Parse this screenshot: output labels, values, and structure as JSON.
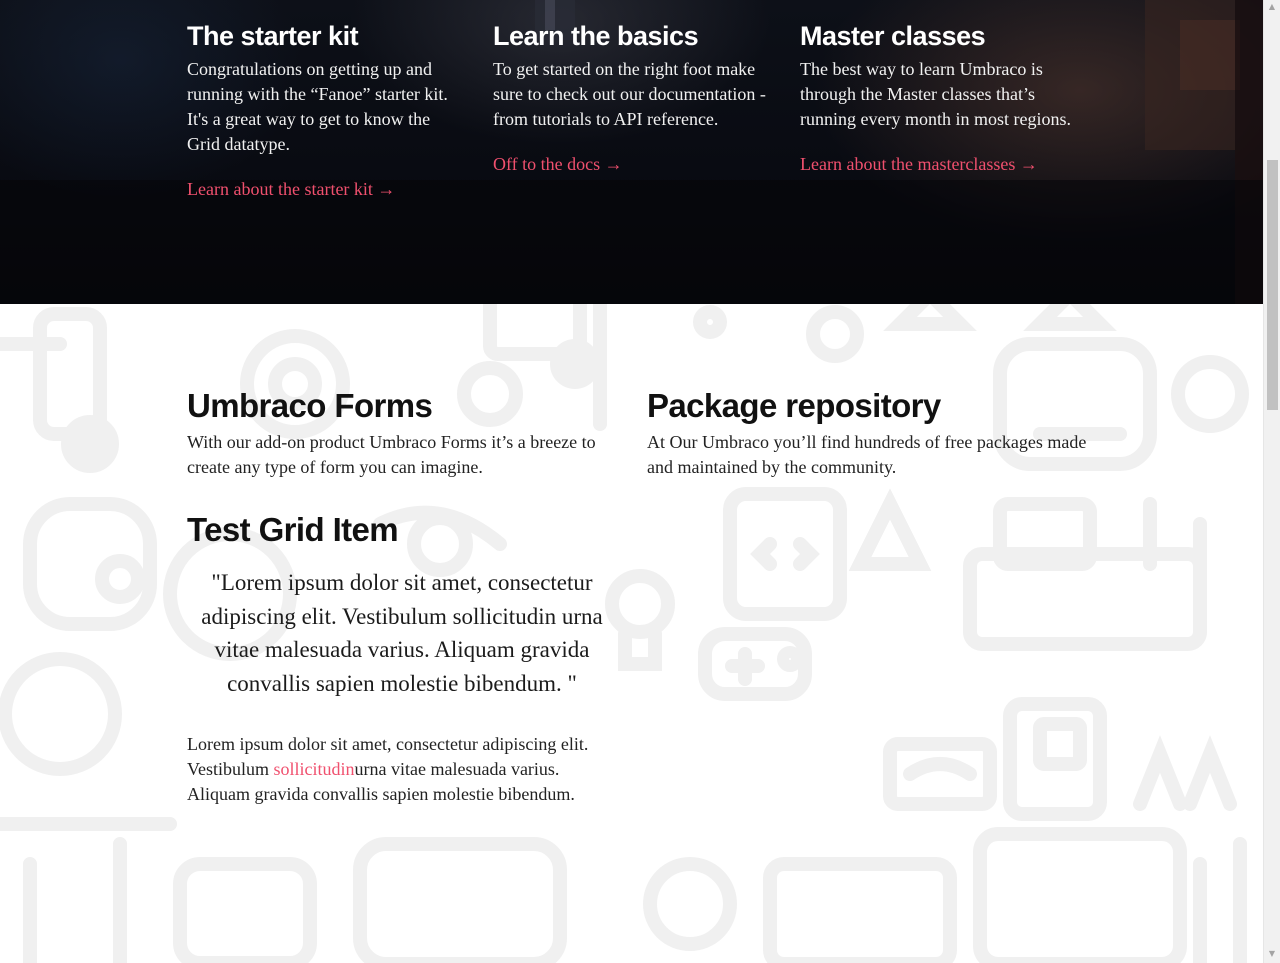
{
  "hero": {
    "columns": [
      {
        "title": "The starter kit",
        "text": "Congratulations on getting up and running with the “Fanoe” starter kit. It's a great way to get to know the Grid datatype.",
        "link": "Learn about the starter kit →"
      },
      {
        "title": "Learn the basics",
        "text": "To get started on the right foot make sure to check out our documentation - from tutorials to API reference.",
        "link": "Off to the docs →"
      },
      {
        "title": "Master classes",
        "text": "The best way to learn Umbraco is through the Master classes that’s running every month in most regions.",
        "link": "Learn about the masterclasses →"
      }
    ]
  },
  "forms": {
    "title": "Umbraco Forms",
    "text": "With our add-on product Umbraco Forms it’s a breeze to create any type of form you can imagine."
  },
  "packages": {
    "title": "Package repository",
    "text": "At Our Umbraco you’ll find hundreds of free packages made and maintained by the community."
  },
  "grid_item": {
    "title": "Test Grid Item",
    "quote_open": "\"",
    "quote": "Lorem ipsum dolor sit amet, consectetur adipiscing elit. Vestibulum sollicitudin urna vitae malesuada varius. Aliquam gravida convallis sapien molestie bibendum.",
    "quote_close": "\"",
    "body_before": "Lorem ipsum dolor sit amet, consectetur adipiscing elit. Vestibulum ",
    "body_link": "sollicitudin",
    "body_after": "urna vitae malesuada varius. Aliquam gravida convallis sapien molestie bibendum."
  },
  "colors": {
    "accent": "#f0506e",
    "hero_bg": "#0b0d14",
    "text": "#1b1b1b"
  },
  "scrollbar": {
    "up_icon": "triangle-up-icon",
    "down_icon": "triangle-down-icon"
  }
}
